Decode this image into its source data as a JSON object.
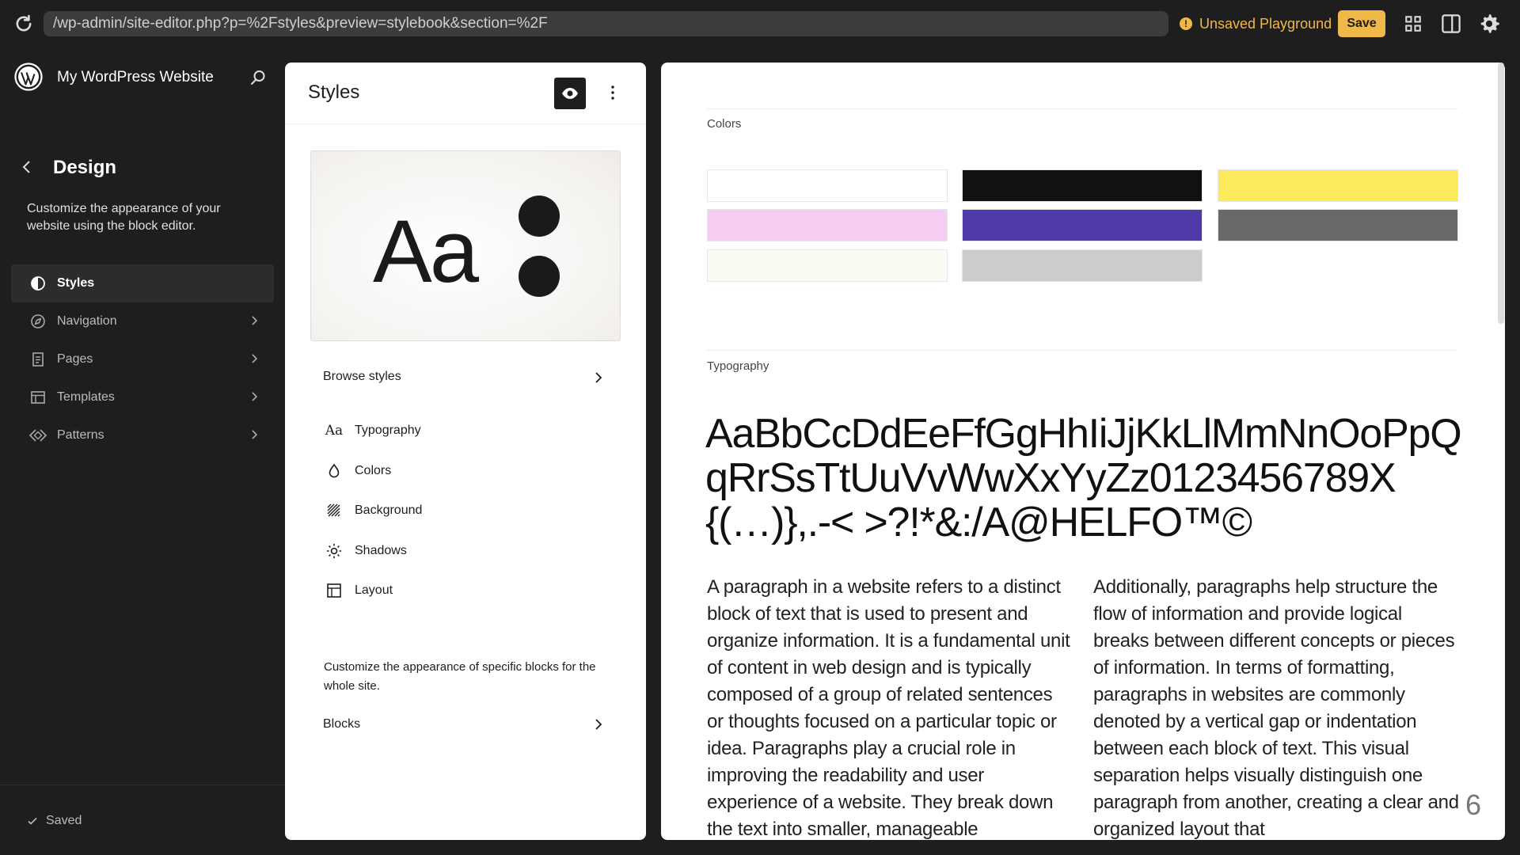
{
  "browser": {
    "url": "/wp-admin/site-editor.php?p=%2Fstyles&preview=stylebook&section=%2F",
    "status": "Unsaved Playground",
    "save_label": "Save"
  },
  "sidebar": {
    "site_name": "My WordPress Website",
    "section_title": "Design",
    "description": "Customize the appearance of your website using the block editor.",
    "items": [
      {
        "label": "Styles",
        "icon": "half-circle-icon"
      },
      {
        "label": "Navigation",
        "icon": "compass-icon"
      },
      {
        "label": "Pages",
        "icon": "page-icon"
      },
      {
        "label": "Templates",
        "icon": "layout-icon"
      },
      {
        "label": "Patterns",
        "icon": "diamond-icon"
      }
    ],
    "footer_status": "Saved"
  },
  "styles_panel": {
    "title": "Styles",
    "preview_text": "Aa",
    "browse_label": "Browse styles",
    "menu": [
      {
        "label": "Typography",
        "icon": "typography-icon"
      },
      {
        "label": "Colors",
        "icon": "droplet-icon"
      },
      {
        "label": "Background",
        "icon": "background-icon"
      },
      {
        "label": "Shadows",
        "icon": "sun-icon"
      },
      {
        "label": "Layout",
        "icon": "layout-icon"
      }
    ],
    "blocks_description": "Customize the appearance of specific blocks for the whole site.",
    "blocks_label": "Blocks"
  },
  "stylebook": {
    "colors_label": "Colors",
    "colors": [
      "#ffffff",
      "#111111",
      "#fde95c",
      "#f5cdf2",
      "#503aa8",
      "#686868",
      "#fbfaf3",
      "#cccccc"
    ],
    "typography_label": "Typography",
    "alphabet": "AaBbCcDdEeFfGgHhIiJjKkLlMmNnOoPpQqRrSsTtUuVvWwXxYyZz0123456789X{(…)},.-< >?!*&:/A@HELFO™©",
    "paragraph_1": "A paragraph in a website refers to a distinct block of text that is used to present and organize information. It is a fundamental unit of content in web design and is typically composed of a group of related sentences or thoughts focused on a particular topic or idea. Paragraphs play a crucial role in improving the readability and user experience of a website. They break down the text into smaller, manageable",
    "paragraph_2": "Additionally, paragraphs help structure the flow of information and provide logical breaks between different concepts or pieces of information. In terms of formatting, paragraphs in websites are commonly denoted by a vertical gap or indentation between each block of text. This visual separation helps visually distinguish one paragraph from another, creating a clear and organized layout that"
  },
  "overlay_number": "6",
  "accent_color": "#f0b849"
}
